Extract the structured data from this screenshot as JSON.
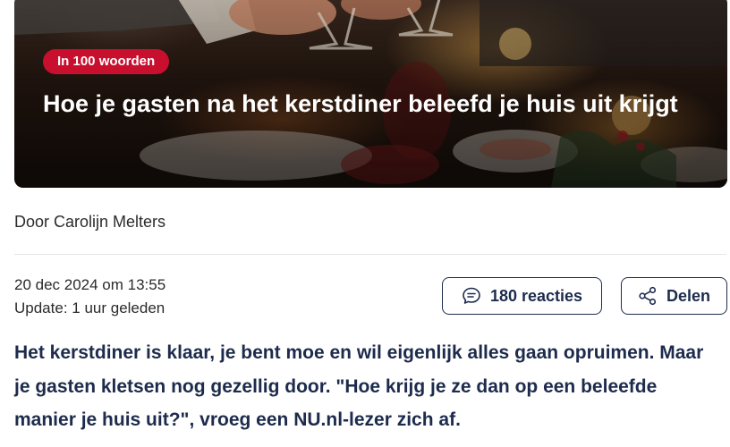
{
  "hero": {
    "badge": "In 100 woorden",
    "headline": "Hoe je gasten na het kerstdiner beleefd je huis uit krijgt"
  },
  "byline": "Door Carolijn Melters",
  "meta": {
    "date": "20 dec 2024 om 13:55",
    "update": "Update: 1 uur geleden"
  },
  "actions": {
    "comments": {
      "icon": "chat-bubble-icon",
      "label": "180 reacties"
    },
    "share": {
      "icon": "share-icon",
      "label": "Delen"
    }
  },
  "intro": "Het kerstdiner is klaar, je bent moe en wil eigenlijk alles gaan opruimen. Maar je gasten kletsen nog gezellig door. \"Hoe krijg je ze dan op een beleefde manier je huis uit?\", vroeg een NU.nl-lezer zich af.",
  "colors": {
    "badge": "#c8102e",
    "navy": "#1d2b4c",
    "text": "#2b2b2b"
  }
}
